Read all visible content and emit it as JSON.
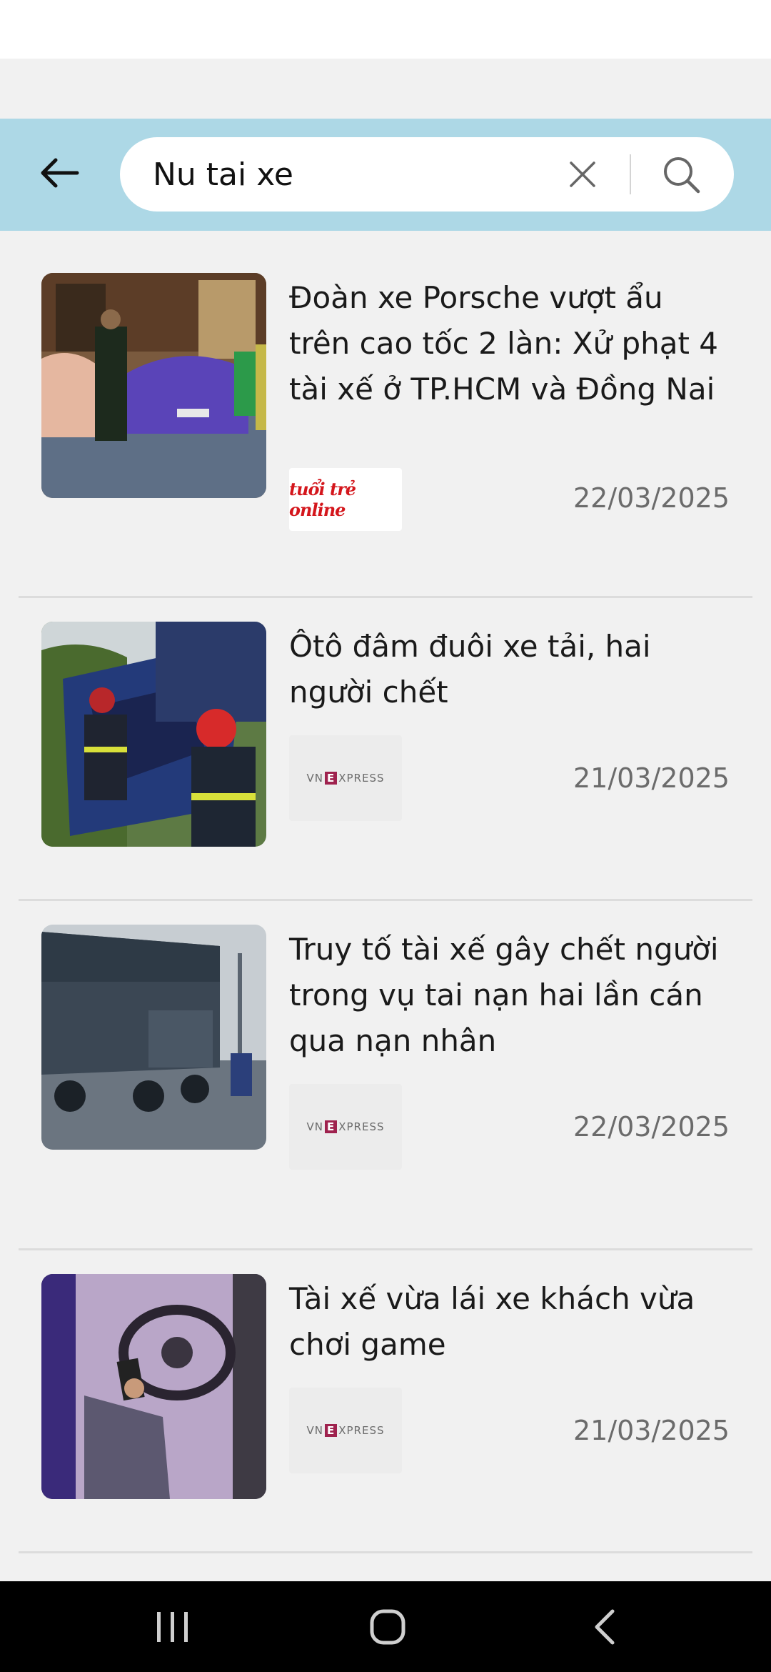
{
  "search": {
    "query": "Nu tai xe"
  },
  "results": [
    {
      "title": "Đoàn xe Porsche vượt ẩu trên cao tốc 2 làn: Xử phạt 4 tài xế ở TP.HCM và Đồng Nai",
      "source": "tuổi trẻ online",
      "source_logo": "tuoitre",
      "date": "22/03/2025",
      "image": "Porsche cars with traffic police officer"
    },
    {
      "title": "Ôtô đâm đuôi xe tải, hai người chết",
      "source": "VnExpress",
      "source_logo": "vnexpress",
      "date": "21/03/2025",
      "image": "Firefighters at wrecked blue car"
    },
    {
      "title": "Truy tố tài xế gây chết người trong vụ tai nạn hai lần cán qua nạn nhân",
      "source": "VnExpress",
      "source_logo": "vnexpress",
      "date": "22/03/2025",
      "image": "Truck on wet road with person crouching"
    },
    {
      "title": "Tài xế vừa lái xe khách vừa chơi game",
      "source": "VnExpress",
      "source_logo": "vnexpress",
      "date": "21/03/2025",
      "image": "Driver holding phone at steering wheel"
    }
  ],
  "colors": {
    "header_bg": "#add8e6",
    "page_bg": "#f1f1f1",
    "cursor": "#0e7c86",
    "nav_bg": "#000000"
  },
  "icons": {
    "back": "arrow-left-icon",
    "clear": "close-icon",
    "search": "search-icon",
    "nav_recents": "recents-icon",
    "nav_home": "home-icon",
    "nav_back": "chevron-left-icon"
  }
}
